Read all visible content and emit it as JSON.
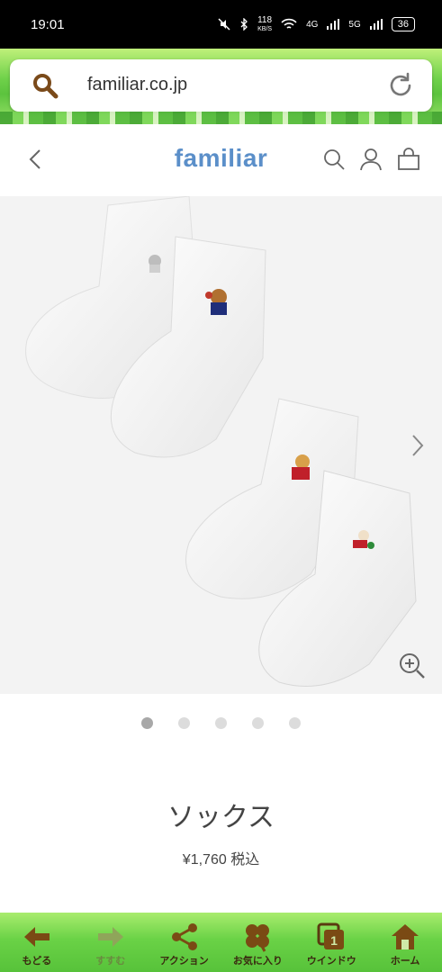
{
  "status_bar": {
    "time": "19:01",
    "network_speed": "118",
    "network_speed_unit": "KB/S",
    "signal_1": "4G",
    "signal_2": "5G",
    "battery": "36"
  },
  "browser": {
    "url": "familiar.co.jp",
    "search_icon": "search-icon",
    "reload_icon": "reload-icon"
  },
  "site_header": {
    "logo": "familiar",
    "back_icon": "chevron-left-icon",
    "icons": [
      "search-icon",
      "user-icon",
      "shopping-bag-icon"
    ]
  },
  "product": {
    "image_alt_icons": [
      "next-arrow-icon",
      "zoom-in-icon"
    ],
    "carousel_count": 5,
    "carousel_active_index": 0,
    "name": "ソックス",
    "price": "¥1,760",
    "tax_label": "税込"
  },
  "toolbar": {
    "items": [
      {
        "label": "もどる",
        "icon": "back-arrow-icon"
      },
      {
        "label": "すすむ",
        "icon": "forward-arrow-icon"
      },
      {
        "label": "アクション",
        "icon": "share-icon"
      },
      {
        "label": "お気に入り",
        "icon": "clover-icon"
      },
      {
        "label": "ウインドウ",
        "icon": "window-icon",
        "badge": "1"
      },
      {
        "label": "ホーム",
        "icon": "home-icon"
      }
    ]
  },
  "colors": {
    "logo": "#5b8fc9",
    "toolbar_green": "#6ad246",
    "dot_active": "#a8a8a8",
    "dot_inactive": "#dcdcdc"
  }
}
